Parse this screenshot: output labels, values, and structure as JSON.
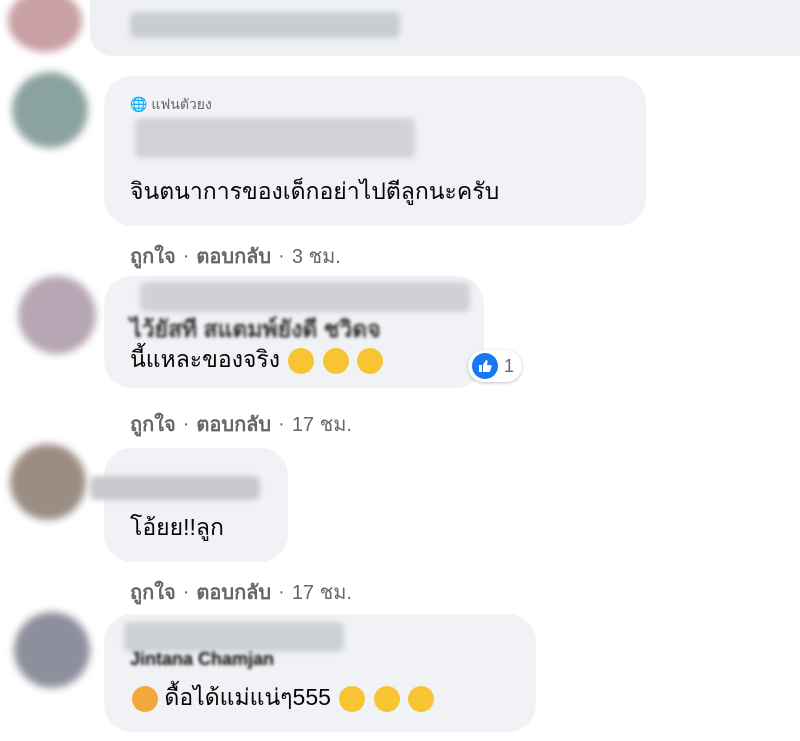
{
  "actions": {
    "like": "ถูกใจ",
    "separator": "·",
    "reply": "ตอบกลับ"
  },
  "comments": [
    {
      "badge": "แฟนตัวยง",
      "text": "จินตนาการของเด็กอย่าไปตีลูกนะครับ",
      "time": "3 ชม."
    },
    {
      "text_line1": "ไว้ยัสที สแตมพ์ยังดี ชวิดจ",
      "text_line2": "นี้แหละของจริง",
      "emojis": [
        "rolling-on-floor-laughing",
        "rolling-on-floor-laughing",
        "rolling-on-floor-laughing"
      ],
      "reaction_count": "1",
      "time": "17 ชม."
    },
    {
      "text": "โอ้ยย!!ลูก",
      "time": "17 ชม."
    },
    {
      "name": "Jintana Chamjan",
      "text": "ดื้อได้แม่แน่ๆ555",
      "emojis_leading": [
        "squinting-tongue"
      ],
      "emojis_trailing": [
        "drooling-face",
        "grinning-face",
        "grinning-face"
      ]
    }
  ]
}
